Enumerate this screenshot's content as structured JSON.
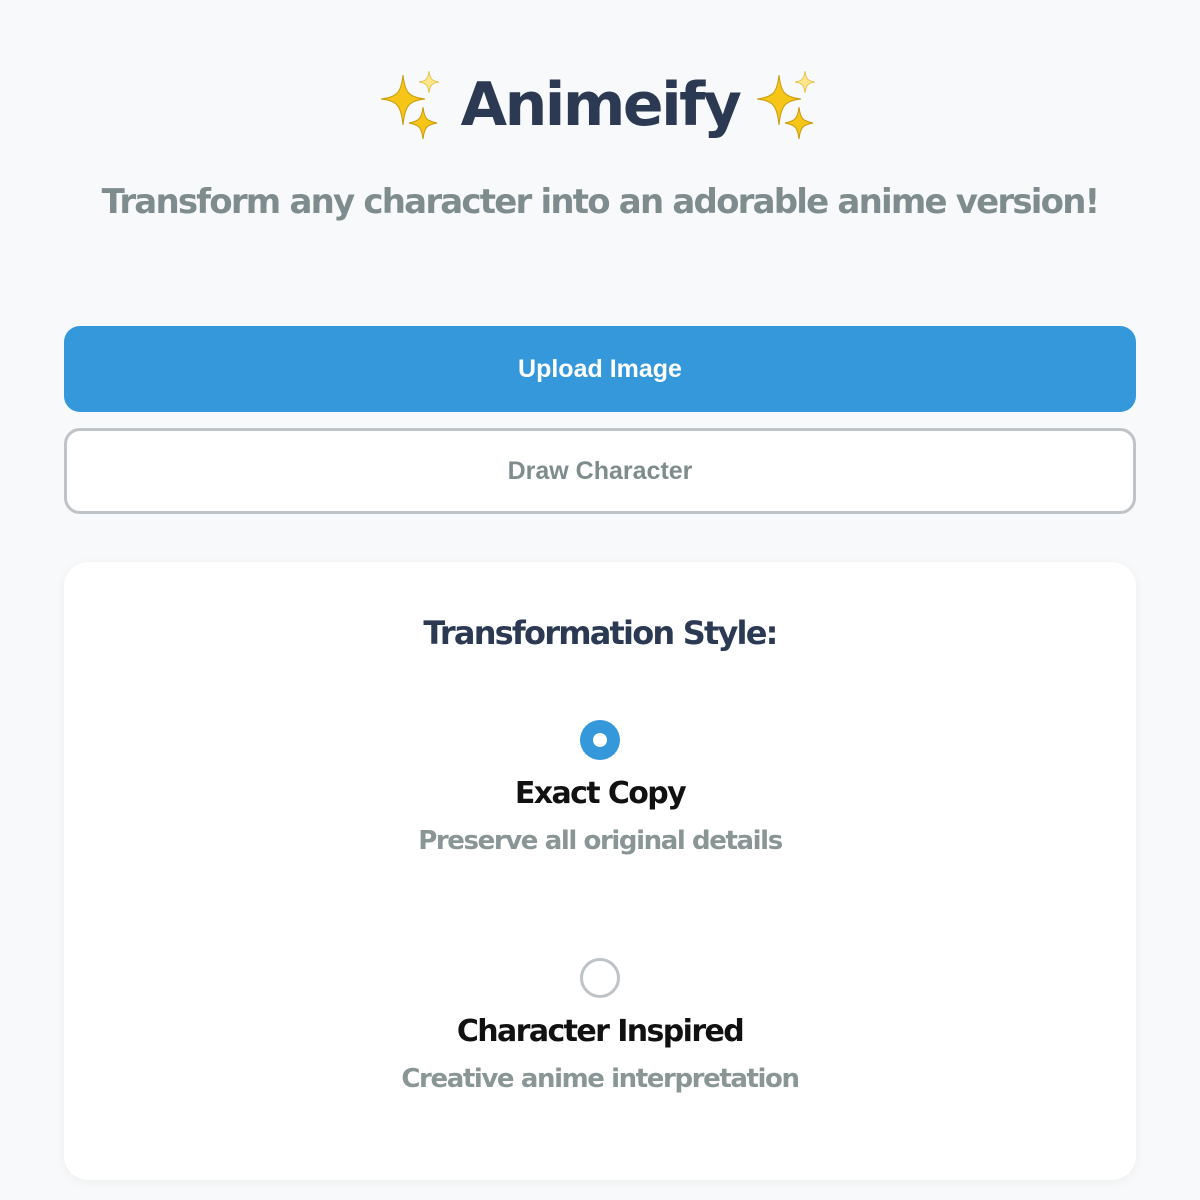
{
  "header": {
    "title": "Animeify",
    "subtitle": "Transform any character into an adorable anime version!",
    "decoration_icon": "sparkles-icon"
  },
  "actions": {
    "upload_label": "Upload Image",
    "draw_label": "Draw Character"
  },
  "style_panel": {
    "title": "Transformation Style:",
    "options": [
      {
        "label": "Exact Copy",
        "description": "Preserve all original details",
        "selected": true
      },
      {
        "label": "Character Inspired",
        "description": "Creative anime interpretation",
        "selected": false
      }
    ]
  },
  "colors": {
    "accent": "#3498db",
    "title": "#2b3a52",
    "muted": "#7f8c8d",
    "border": "#bdc3c7",
    "background": "#f7f9fa",
    "sparkle": "#f5c518"
  }
}
